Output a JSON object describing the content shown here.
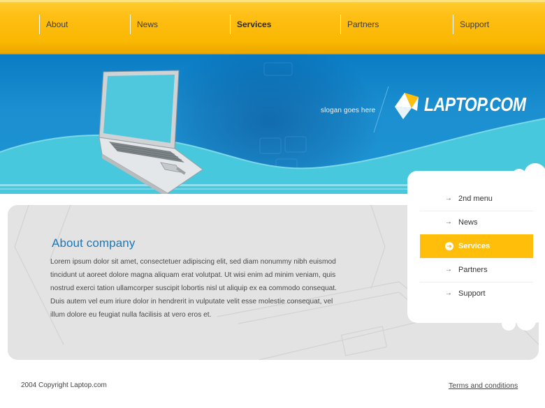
{
  "nav": {
    "items": [
      {
        "label": "About"
      },
      {
        "label": "News"
      },
      {
        "label": "Services"
      },
      {
        "label": "Partners"
      },
      {
        "label": "Support"
      }
    ],
    "active": "Services"
  },
  "banner": {
    "slogan": "slogan goes here",
    "logo_text": "LAPTOP.COM"
  },
  "content": {
    "title": "About company",
    "body": "Lorem ipsum dolor sit amet, consectetuer adipiscing elit, sed diam nonummy nibh euismod tincidunt ut aoreet dolore magna aliquam erat volutpat. Ut wisi enim ad minim veniam, quis nostrud exerci tation ullamcorper suscipit lobortis nisl ut aliquip ex ea commodo consequat. Duis autem vel eum iriure dolor in hendrerit in vulputate velit esse molestie consequat, vel illum dolore eu feugiat nulla facilisis at vero eros et."
  },
  "sidemenu": {
    "items": [
      {
        "label": "2nd menu"
      },
      {
        "label": "News"
      },
      {
        "label": "Services"
      },
      {
        "label": "Partners"
      },
      {
        "label": "Support"
      }
    ],
    "active": "Services"
  },
  "footer": {
    "copyright": "2004 Copyright Laptop.com",
    "terms": "Terms and conditions"
  },
  "colors": {
    "nav_yellow": "#ffbe14",
    "banner_blue": "#1b8fd0",
    "wave_cyan": "#48c8dc",
    "title_blue": "#1b78b8",
    "active_orange": "#ffbe0a",
    "panel_gray": "#e3e3e3"
  },
  "icons": {
    "side_arrow": "arrow-right-icon",
    "active_side_arrow": "circle-arrow-right-icon",
    "logo": "diamond-logo-icon"
  }
}
